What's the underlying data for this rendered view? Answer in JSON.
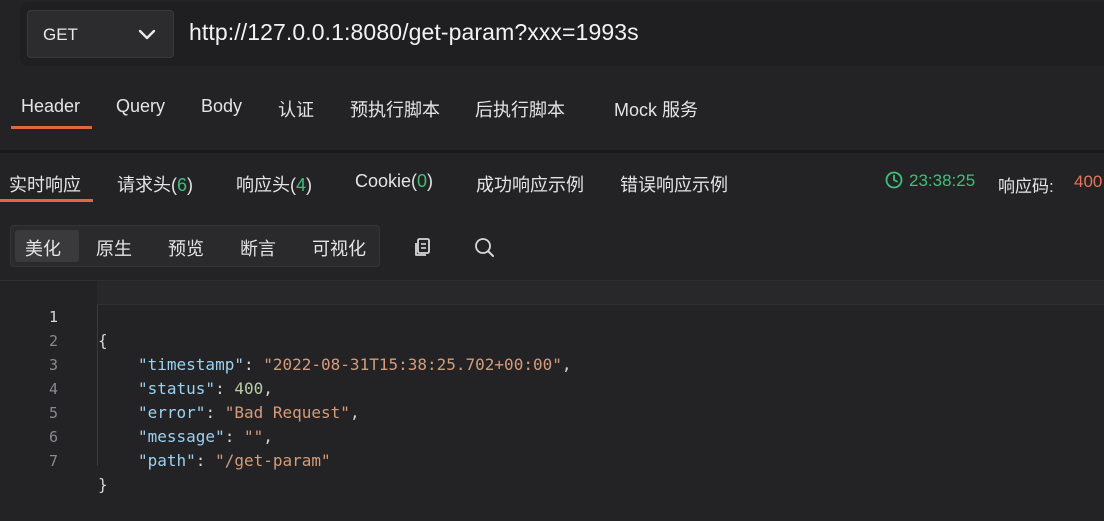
{
  "request": {
    "method": "GET",
    "url": "http://127.0.0.1:8080/get-param?xxx=1993s"
  },
  "request_tabs": [
    {
      "label": "Header",
      "active": true
    },
    {
      "label": "Query"
    },
    {
      "label": "Body"
    },
    {
      "label": "认证"
    },
    {
      "label": "预执行脚本"
    },
    {
      "label": "后执行脚本"
    },
    {
      "label": "Mock 服务"
    }
  ],
  "response_tabs": {
    "realtime": "实时响应",
    "req_headers": "请求头(",
    "req_headers_count": "6",
    "resp_headers": "响应头(",
    "resp_headers_count": "4",
    "cookie": "Cookie(",
    "cookie_count": "0",
    "close_paren": ")",
    "success_example": "成功响应示例",
    "error_example": "错误响应示例"
  },
  "response_meta": {
    "time": "23:38:25",
    "code_label": "响应码:",
    "code_value": "400"
  },
  "view_modes": [
    "美化",
    "原生",
    "预览",
    "断言",
    "可视化"
  ],
  "editor": {
    "line_numbers": [
      "1",
      "2",
      "3",
      "4",
      "5",
      "6",
      "7"
    ],
    "json": {
      "open": "{",
      "close": "}",
      "timestamp_key": "\"timestamp\"",
      "timestamp_val": "\"2022-08-31T15:38:25.702+00:00\"",
      "status_key": "\"status\"",
      "status_val": "400",
      "error_key": "\"error\"",
      "error_val": "\"Bad Request\"",
      "message_key": "\"message\"",
      "message_val": "\"\"",
      "path_key": "\"path\"",
      "path_val": "\"/get-param\"",
      "colon": ": ",
      "comma": ","
    }
  },
  "colors": {
    "accent": "#e2673a",
    "success": "#3fbf7a",
    "error_code": "#e8735a"
  },
  "icons": [
    "chevron-down-icon",
    "clock-icon",
    "copy-icon",
    "search-icon"
  ]
}
